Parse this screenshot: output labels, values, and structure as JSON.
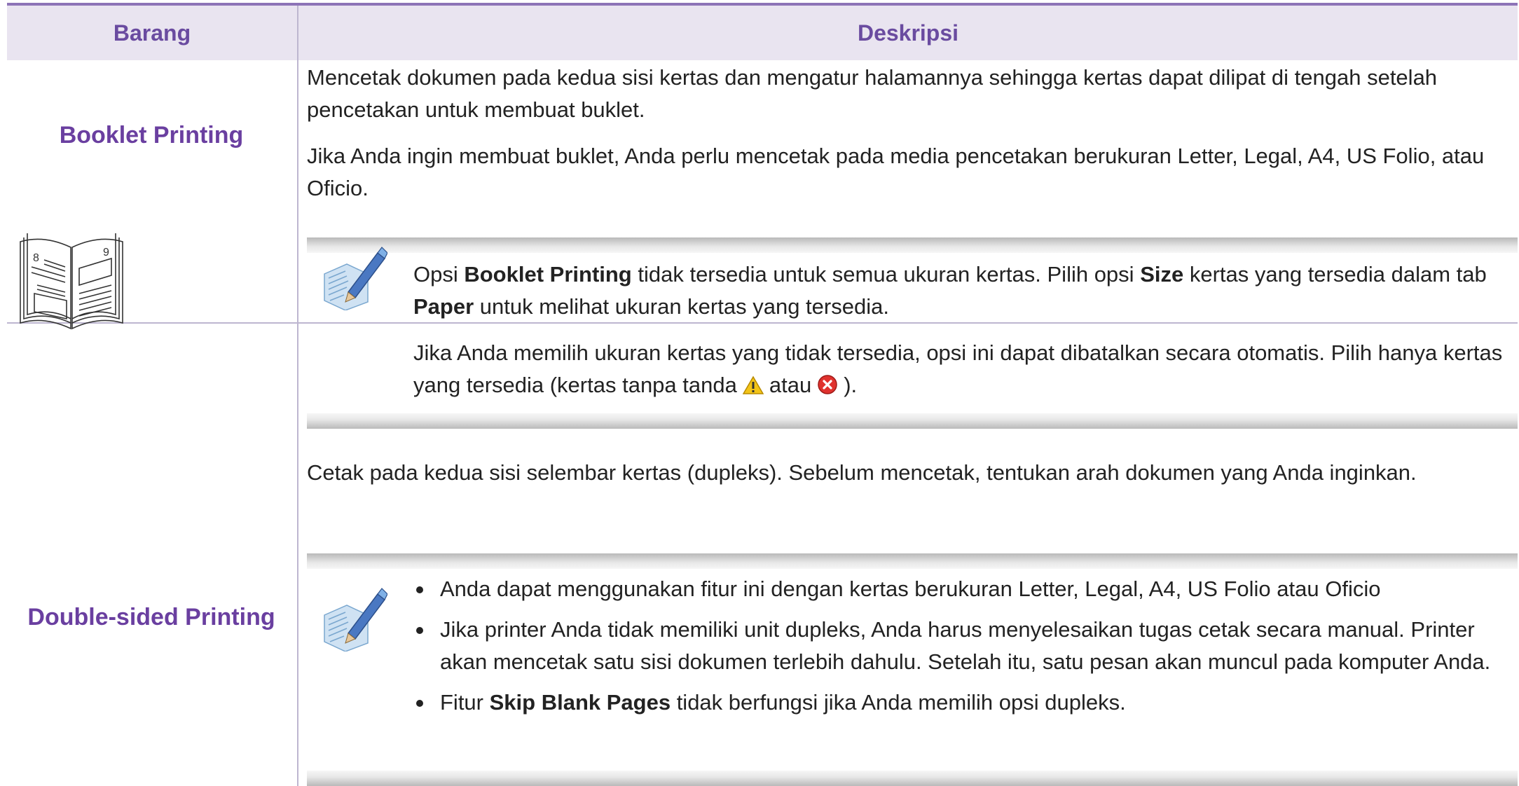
{
  "table": {
    "header": {
      "item": "Barang",
      "description": "Deskripsi"
    },
    "rows": [
      {
        "label": "Booklet Printing",
        "paragraphs": [
          "Mencetak dokumen pada kedua sisi kertas dan mengatur halamannya sehingga kertas dapat dilipat di tengah setelah pencetakan untuk membuat buklet.",
          "Jika Anda ingin membuat buklet, Anda perlu mencetak pada media pencetakan berukuran Letter, Legal, A4, US Folio, atau Oficio."
        ],
        "illustration": {
          "icon": "booklet-icon",
          "left_page": "8",
          "right_page": "9"
        },
        "note": {
          "icon": "note-pencil-icon",
          "p1": {
            "t1": "Opsi ",
            "b1": "Booklet Printing",
            "t2": " tidak tersedia untuk semua ukuran kertas. Pilih opsi ",
            "b2": "Size",
            "t3": " kertas yang tersedia dalam tab ",
            "b3": "Paper",
            "t4": " untuk melihat ukuran kertas yang tersedia."
          },
          "p2": {
            "t1": "Jika Anda memilih ukuran kertas yang tidak tersedia, opsi ini dapat dibatalkan secara otomatis. Pilih hanya kertas yang tersedia (kertas tanpa tanda",
            "t2": "atau",
            "t3": ").",
            "warning_icon": "warning-icon",
            "error_icon": "error-icon"
          }
        }
      },
      {
        "label": "Double-sided Printing",
        "paragraphs": [
          "Cetak pada kedua sisi selembar kertas (dupleks). Sebelum mencetak, tentukan arah dokumen yang Anda inginkan."
        ],
        "note": {
          "icon": "note-pencil-icon",
          "bullets": [
            {
              "text": "Anda dapat menggunakan fitur ini dengan kertas berukuran Letter, Legal, A4, US Folio atau Oficio"
            },
            {
              "text": "Jika printer Anda tidak memiliki unit dupleks, Anda harus menyelesaikan tugas cetak secara manual. Printer akan mencetak satu sisi dokumen terlebih dahulu. Setelah itu, satu pesan akan muncul pada komputer Anda."
            },
            {
              "t1": "Fitur ",
              "b1": "Skip Blank Pages",
              "t2": " tidak berfungsi jika Anda memilih opsi dupleks."
            }
          ]
        }
      }
    ]
  },
  "colors": {
    "accent": "#6a3fa0",
    "header_bg": "#e9e4f0",
    "rule": "#bdb6d0"
  }
}
